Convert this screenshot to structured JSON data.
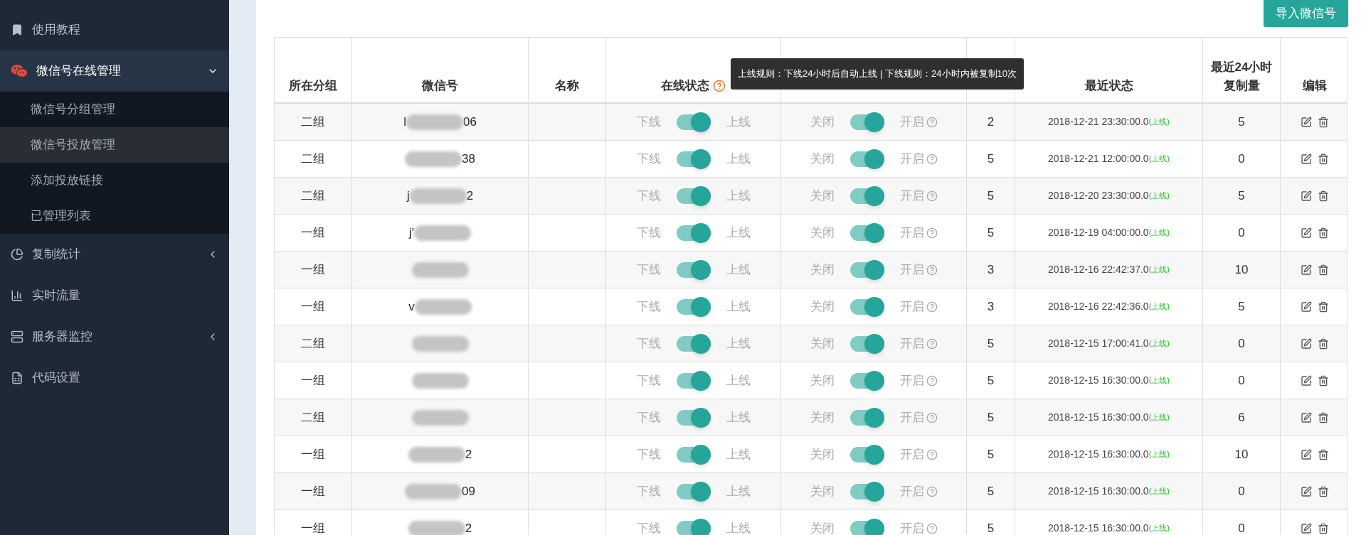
{
  "sidebar": {
    "items": [
      {
        "label": "使用教程"
      },
      {
        "label": "微信号在线管理",
        "expanded": true,
        "children": [
          {
            "label": "微信号分组管理",
            "selected": false
          },
          {
            "label": "微信号投放管理",
            "selected": true
          },
          {
            "label": "添加投放链接",
            "selected": false
          },
          {
            "label": "已管理列表",
            "selected": false
          }
        ]
      },
      {
        "label": "复制统计",
        "expanded": false
      },
      {
        "label": "实时流量"
      },
      {
        "label": "服务器监控",
        "expanded": false
      },
      {
        "label": "代码设置"
      }
    ]
  },
  "import_button": "导入微信号",
  "table": {
    "columns": [
      "所在分组",
      "微信号",
      "名称",
      "在线状态",
      "最近状态",
      "最近24小时复制量",
      "编辑"
    ],
    "tooltip": "上线规则：下线24小时后自动上线 | 下线规则：24小时内被复制10次",
    "rows": [
      {
        "group": "二组",
        "wechat_start": "l",
        "wechat_end": "06",
        "online_off": "下线",
        "online": true,
        "online_on": "上线",
        "auto_off": "关闭",
        "auto": true,
        "auto_on": "开启",
        "weight": "2",
        "time": "2018-12-21 23:30:00.0",
        "status": "(上线)",
        "copies": "5"
      },
      {
        "group": "二组",
        "wechat_start": "",
        "wechat_end": "38",
        "online_off": "下线",
        "online": true,
        "online_on": "上线",
        "auto_off": "关闭",
        "auto": true,
        "auto_on": "开启",
        "weight": "5",
        "time": "2018-12-21 12:00:00.0",
        "status": "(上线)",
        "copies": "0"
      },
      {
        "group": "二组",
        "wechat_start": "j",
        "wechat_end": "2",
        "online_off": "下线",
        "online": true,
        "online_on": "上线",
        "auto_off": "关闭",
        "auto": true,
        "auto_on": "开启",
        "weight": "5",
        "time": "2018-12-20 23:30:00.0",
        "status": "(上线)",
        "copies": "5"
      },
      {
        "group": "一组",
        "wechat_start": "j'",
        "wechat_end": "",
        "online_off": "下线",
        "online": true,
        "online_on": "上线",
        "auto_off": "关闭",
        "auto": true,
        "auto_on": "开启",
        "weight": "5",
        "time": "2018-12-19 04:00:00.0",
        "status": "(上线)",
        "copies": "0"
      },
      {
        "group": "一组",
        "wechat_start": "",
        "wechat_end": "",
        "online_off": "下线",
        "online": true,
        "online_on": "上线",
        "auto_off": "关闭",
        "auto": true,
        "auto_on": "开启",
        "weight": "3",
        "time": "2018-12-16 22:42:37.0",
        "status": "(上线)",
        "copies": "10"
      },
      {
        "group": "一组",
        "wechat_start": "v",
        "wechat_end": "",
        "online_off": "下线",
        "online": true,
        "online_on": "上线",
        "auto_off": "关闭",
        "auto": true,
        "auto_on": "开启",
        "weight": "3",
        "time": "2018-12-16 22:42:36.0",
        "status": "(上线)",
        "copies": "5"
      },
      {
        "group": "二组",
        "wechat_start": "",
        "wechat_end": "",
        "online_off": "下线",
        "online": true,
        "online_on": "上线",
        "auto_off": "关闭",
        "auto": true,
        "auto_on": "开启",
        "weight": "5",
        "time": "2018-12-15 17:00:41.0",
        "status": "(上线)",
        "copies": "0"
      },
      {
        "group": "一组",
        "wechat_start": "",
        "wechat_end": "",
        "online_off": "下线",
        "online": true,
        "online_on": "上线",
        "auto_off": "关闭",
        "auto": true,
        "auto_on": "开启",
        "weight": "5",
        "time": "2018-12-15 16:30:00.0",
        "status": "(上线)",
        "copies": "0"
      },
      {
        "group": "二组",
        "wechat_start": "",
        "wechat_end": "",
        "online_off": "下线",
        "online": true,
        "online_on": "上线",
        "auto_off": "关闭",
        "auto": true,
        "auto_on": "开启",
        "weight": "5",
        "time": "2018-12-15 16:30:00.0",
        "status": "(上线)",
        "copies": "6"
      },
      {
        "group": "一组",
        "wechat_start": "",
        "wechat_end": "2",
        "online_off": "下线",
        "online": true,
        "online_on": "上线",
        "auto_off": "关闭",
        "auto": true,
        "auto_on": "开启",
        "weight": "5",
        "time": "2018-12-15 16:30:00.0",
        "status": "(上线)",
        "copies": "10"
      },
      {
        "group": "一组",
        "wechat_start": "",
        "wechat_end": "09",
        "online_off": "下线",
        "online": true,
        "online_on": "上线",
        "auto_off": "关闭",
        "auto": true,
        "auto_on": "开启",
        "weight": "5",
        "time": "2018-12-15 16:30:00.0",
        "status": "(上线)",
        "copies": "0"
      },
      {
        "group": "一组",
        "wechat_start": "",
        "wechat_end": "2",
        "online_off": "下线",
        "online": true,
        "online_on": "上线",
        "auto_off": "关闭",
        "auto": true,
        "auto_on": "开启",
        "weight": "5",
        "time": "2018-12-15 16:30:00.0",
        "status": "(上线)",
        "copies": "0"
      }
    ]
  }
}
